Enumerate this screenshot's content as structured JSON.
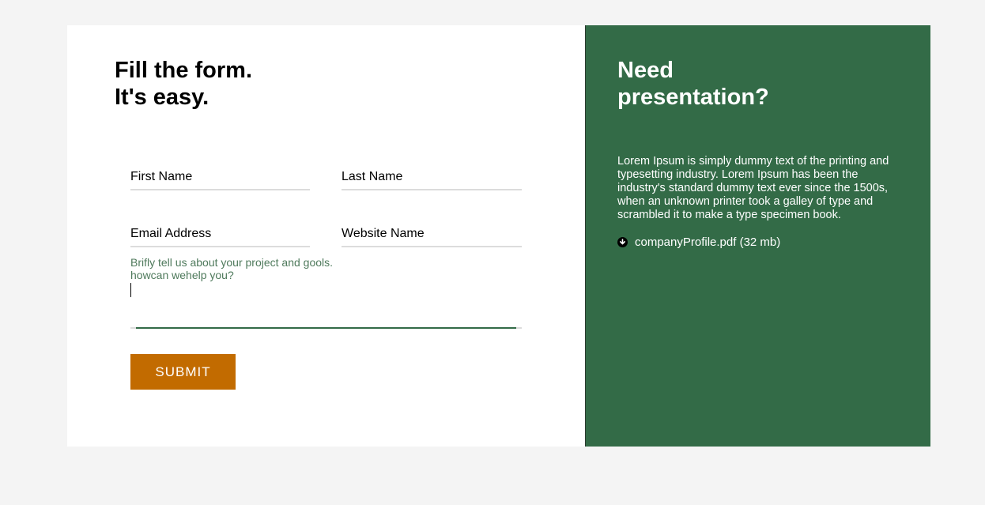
{
  "form": {
    "title_line1": "Fill the form.",
    "title_line2": "It's easy.",
    "first_name_placeholder": "First Name",
    "last_name_placeholder": "Last Name",
    "email_placeholder": "Email Address",
    "website_placeholder": "Website Name",
    "message_placeholder": "Brifly tell us about your project and gools.\nhowcan wehelp you?",
    "submit_label": "SUBMIT"
  },
  "info": {
    "title_line1": "Need",
    "title_line2": "presentation?",
    "description": "Lorem Ipsum is simply dummy text of the printing and typesetting industry. Lorem Ipsum has been the industry's standard dummy text ever since the 1500s, when an unknown printer took a galley of type and scrambled it to make a type specimen book.",
    "download_label": "companyProfile.pdf (32 mb)",
    "download_icon": "download-circle-icon"
  },
  "colors": {
    "page_background": "#f4f4f4",
    "form_background": "#ffffff",
    "info_background": "#336b47",
    "accent_button": "#c26b00",
    "focus_underline": "#336b47",
    "placeholder_hint": "#4f7a5c"
  }
}
